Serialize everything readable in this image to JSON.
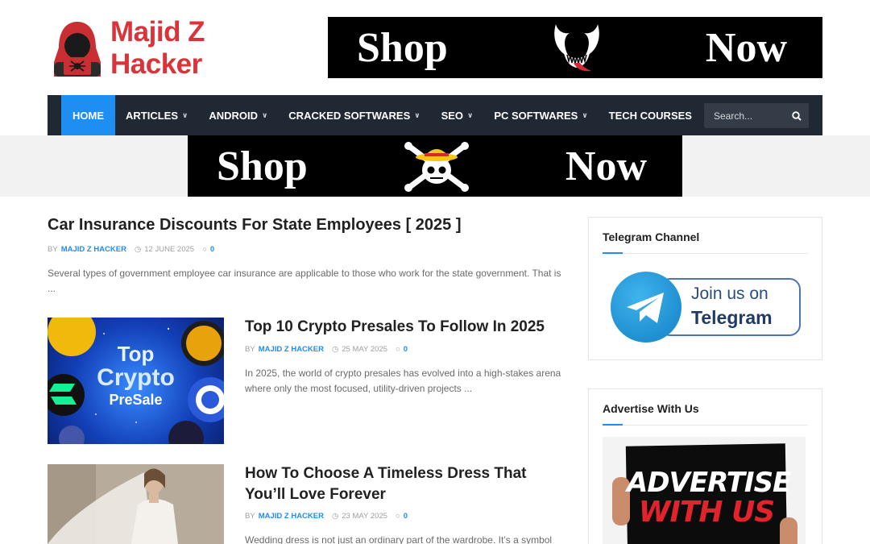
{
  "brand": {
    "name": "Majid Z Hacker"
  },
  "banners": {
    "top": {
      "left_word": "Shop",
      "right_word": "Now"
    },
    "middle": {
      "left_word": "Shop",
      "right_word": "Now"
    }
  },
  "nav": {
    "items": [
      {
        "label": "Home",
        "dropdown": false,
        "active": true
      },
      {
        "label": "Articles",
        "dropdown": true
      },
      {
        "label": "Android",
        "dropdown": true
      },
      {
        "label": "Cracked Softwares",
        "dropdown": true
      },
      {
        "label": "SEO",
        "dropdown": true
      },
      {
        "label": "PC Softwares",
        "dropdown": true
      },
      {
        "label": "Tech Courses",
        "dropdown": false
      }
    ],
    "search_placeholder": "Search..."
  },
  "articles": [
    {
      "title": "Car Insurance Discounts For State Employees [ 2025 ]",
      "by": "BY",
      "author": "MAJID Z HACKER",
      "date": "12 JUNE 2025",
      "comments": "0",
      "excerpt": "Several types of government employee car insurance are applicable to those who work for the state government.   That is ..."
    },
    {
      "title": "Top 10 Crypto Presales To Follow In 2025",
      "by": "BY",
      "author": "MAJID Z HACKER",
      "date": "25 MAY 2025",
      "comments": "0",
      "excerpt": "In 2025, the world of crypto presales has evolved into a high-stakes arena where only the most focused, utility-driven projects ...",
      "thumb_text": [
        "Top",
        "Crypto",
        "PreSale"
      ]
    },
    {
      "title": "How To Choose A Timeless Dress That You’ll Love Forever",
      "by": "BY",
      "author": "MAJID Z HACKER",
      "date": "23 MAY 2025",
      "comments": "0",
      "excerpt": "Wedding dress is not just an ordinary part of the wardrobe. It’s a symbol"
    }
  ],
  "sidebar": {
    "telegram": {
      "title": "Telegram Channel",
      "line1": "Join us on",
      "line2": "Telegram"
    },
    "advertise": {
      "title": "Advertise With Us",
      "line1": "ADVERTISE",
      "line2": "WITH US"
    }
  },
  "colors": {
    "accent": "#1e8ef2",
    "nav_bg": "#1f2833",
    "logo_red": "#d9343a"
  }
}
